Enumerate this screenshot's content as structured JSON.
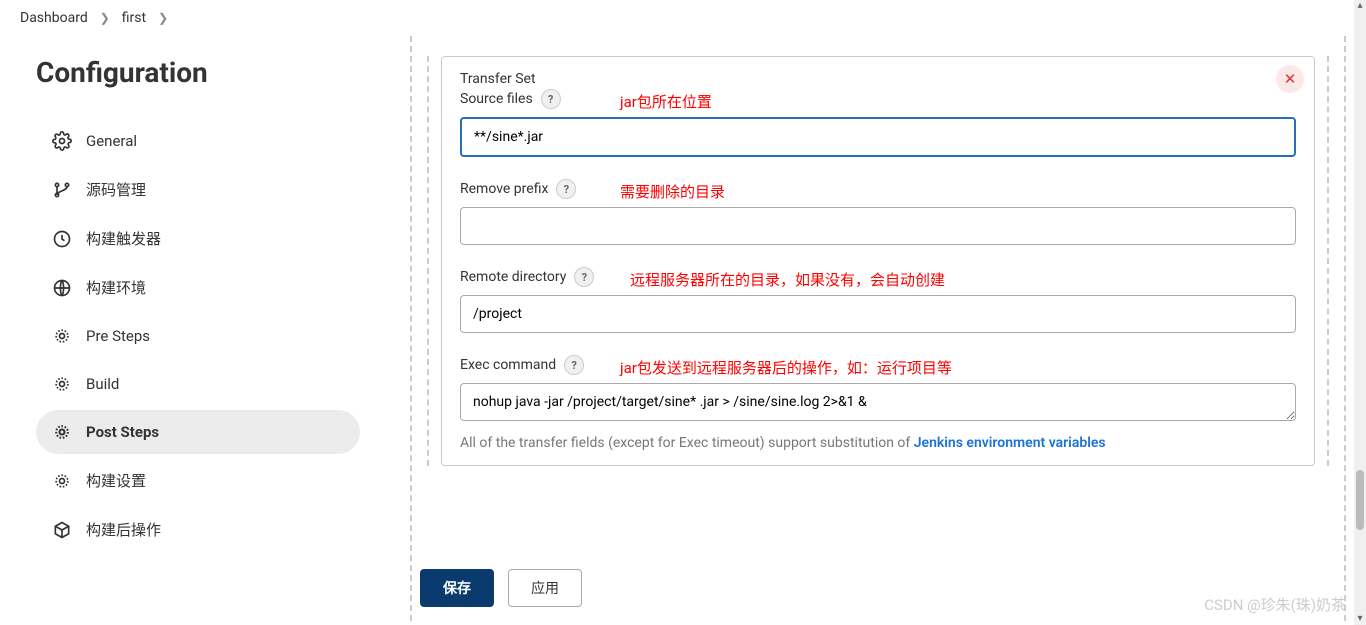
{
  "breadcrumb": {
    "items": [
      "Dashboard",
      "first"
    ]
  },
  "page_title": "Configuration",
  "sidebar": {
    "items": [
      {
        "label": "General",
        "icon": "gear"
      },
      {
        "label": "源码管理",
        "icon": "branch"
      },
      {
        "label": "构建触发器",
        "icon": "clock"
      },
      {
        "label": "构建环境",
        "icon": "globe"
      },
      {
        "label": "Pre Steps",
        "icon": "gear"
      },
      {
        "label": "Build",
        "icon": "gear"
      },
      {
        "label": "Post Steps",
        "icon": "gear",
        "active": true
      },
      {
        "label": "构建设置",
        "icon": "gear"
      },
      {
        "label": "构建后操作",
        "icon": "package"
      }
    ]
  },
  "panel": {
    "section_title": "Transfer Set",
    "fields": {
      "source_files": {
        "label": "Source files",
        "value": "**/sine*.jar",
        "annotation": "jar包所在位置"
      },
      "remove_prefix": {
        "label": "Remove prefix",
        "value": "",
        "annotation": "需要删除的目录"
      },
      "remote_directory": {
        "label": "Remote directory",
        "value": "/project",
        "annotation": "远程服务器所在的目录，如果没有，会自动创建"
      },
      "exec_command": {
        "label": "Exec command",
        "value": "nohup java -jar /project/target/sine* .jar > /sine/sine.log 2>&1 &",
        "annotation": "jar包发送到远程服务器后的操作，如：运行项目等"
      }
    },
    "footnote_text": "All of the transfer fields (except for Exec timeout) support substitution of ",
    "footnote_link": "Jenkins environment variables"
  },
  "buttons": {
    "save": "保存",
    "apply": "应用"
  },
  "watermark": "CSDN @珍朱(珠)奶茶"
}
